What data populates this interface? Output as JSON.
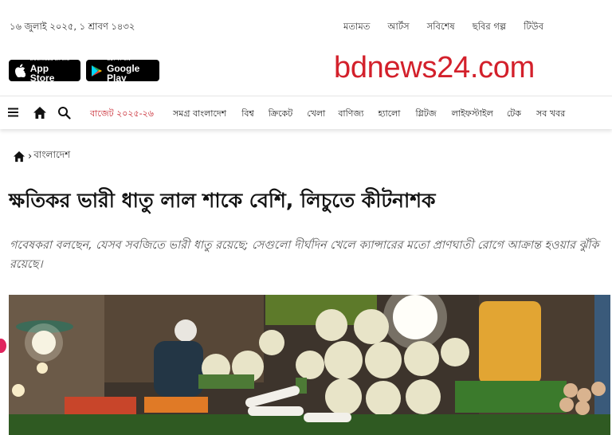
{
  "topbar": {
    "date": "১৬ জুলাই ২০২৫, ১ শ্রাবণ ১৪৩২",
    "links": [
      "মতামত",
      "আর্টস",
      "সবিশেষ",
      "ছবির গল্প",
      "টিউব"
    ]
  },
  "apps": {
    "apple_small": "Download on the",
    "apple_big": "App Store",
    "google_small": "GET IT ON",
    "google_big": "Google Play"
  },
  "logo": "bdnews24.com",
  "nav": {
    "items": [
      {
        "label": "বাজেট ২০২৫-২৬",
        "highlight": true
      },
      {
        "label": "সমগ্র বাংলাদেশ"
      },
      {
        "label": "বিশ্ব"
      },
      {
        "label": "ক্রিকেট"
      },
      {
        "label": "খেলা"
      },
      {
        "label": "বাণিজ্য"
      },
      {
        "label": "হ্যালো"
      },
      {
        "label": "গ্লিটজ"
      },
      {
        "label": "লাইফস্টাইল"
      },
      {
        "label": "টেক"
      },
      {
        "label": "সব খবর"
      }
    ]
  },
  "breadcrumb": {
    "section": "বাংলাদেশ"
  },
  "article": {
    "headline": "ক্ষতিকর ভারী ধাতু লাল শাকে বেশি, লিচুতে কীটনাশক",
    "summary": "গবেষকরা বলছেন, যেসব সবজিতে ভারী ধাতু রয়েছে; সেগুলো দীর্ঘদিন খেলে ক্যান্সারের মতো প্রাণঘাতী রোগে আক্রান্ত হওয়ার ঝুঁকি রয়েছে।"
  },
  "colors": {
    "brand": "#d3202b",
    "highlight": "#c7232d"
  }
}
